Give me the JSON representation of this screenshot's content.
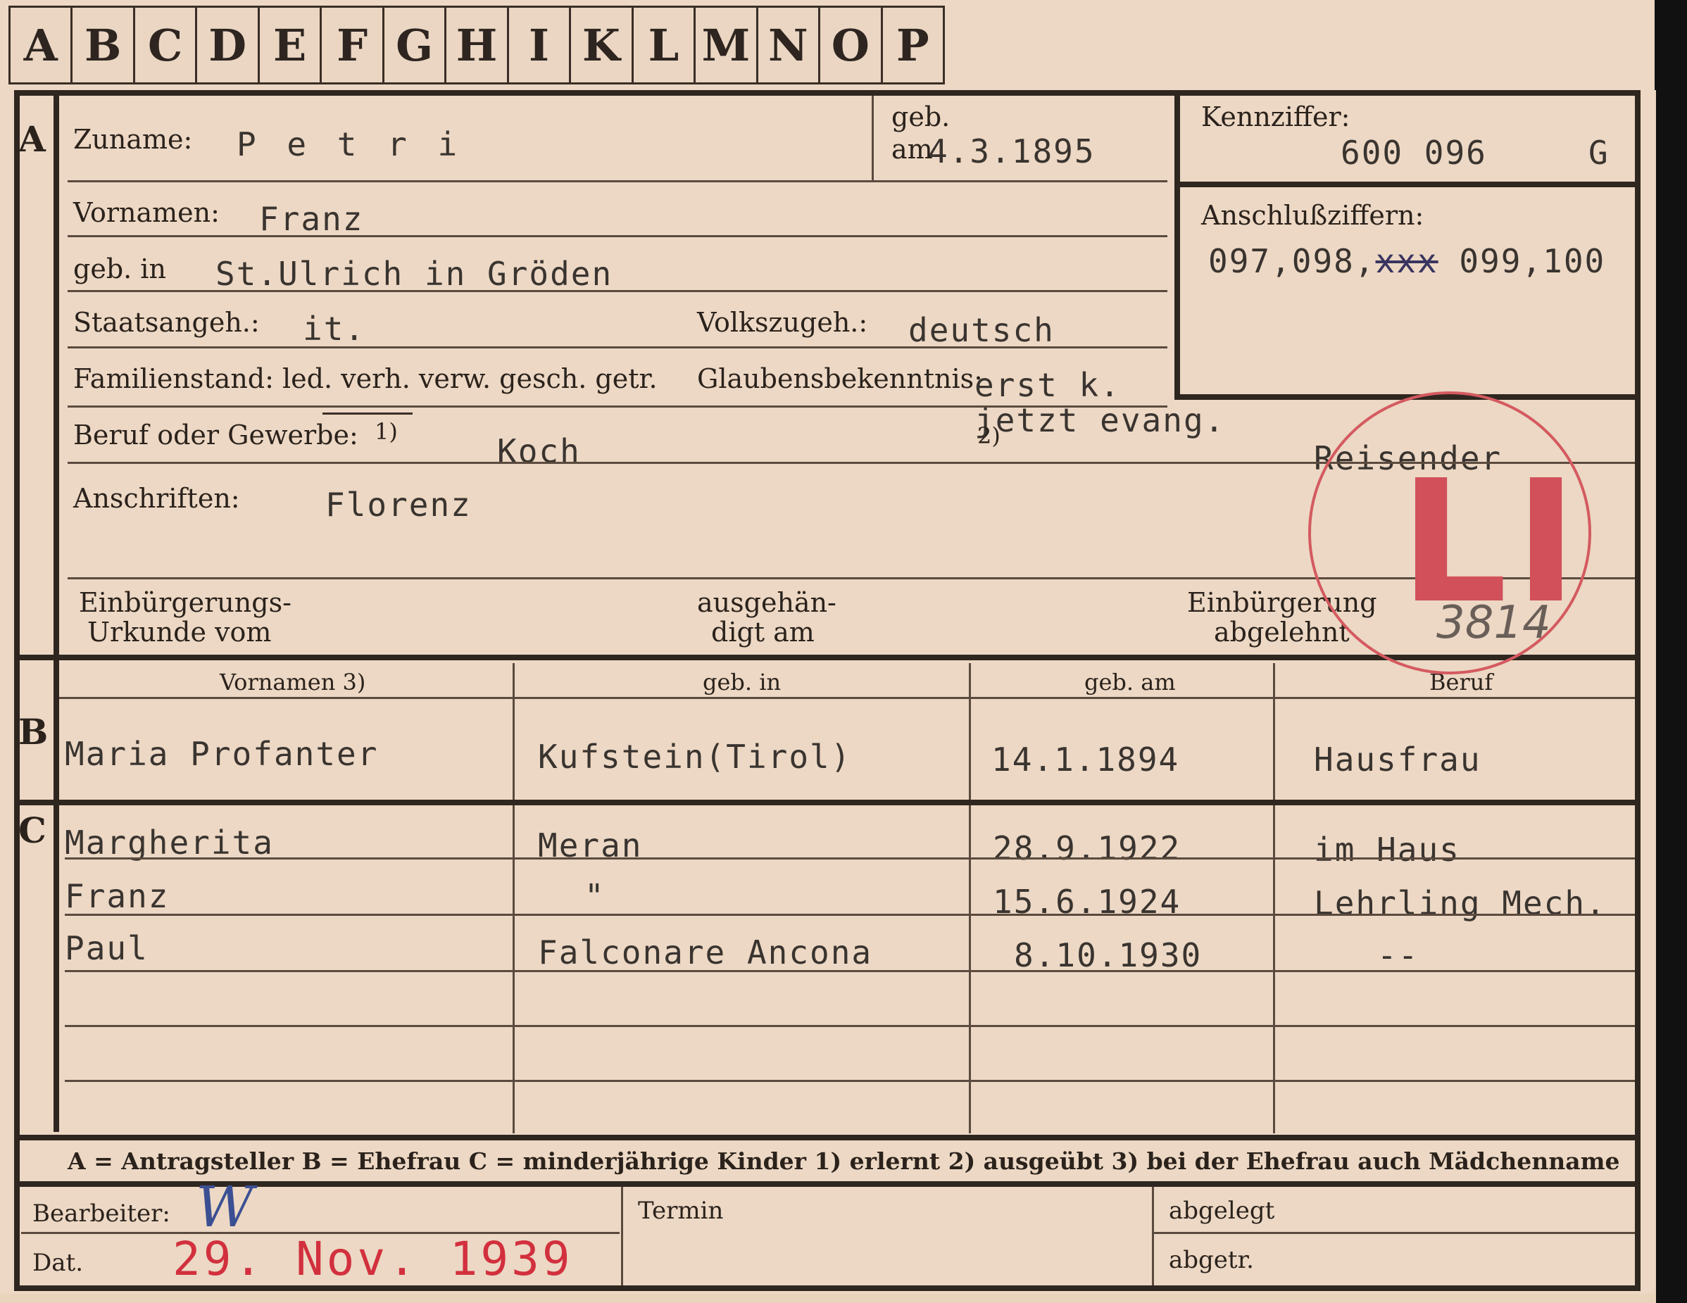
{
  "tabs": [
    "A",
    "B",
    "C",
    "D",
    "E",
    "F",
    "G",
    "H",
    "I",
    "K",
    "L",
    "M",
    "N",
    "O",
    "P"
  ],
  "section_letters": {
    "a": "A",
    "b": "B",
    "c": "C"
  },
  "applicant": {
    "surname_label": "Zuname:",
    "surname": "P e t r i",
    "born_on_label": "geb.",
    "born_on_am": "am",
    "born_on": "4.3.1895",
    "id_label": "Kennziffer:",
    "id": "600 096",
    "id_suffix": "G",
    "link_label": "Anschlußziffern:",
    "link_prefix": "097,098,",
    "link_struck": "xxx",
    "link_rest": " 099,100",
    "firstname_label": "Vornamen:",
    "firstname": "Franz",
    "birthplace_label": "geb. in",
    "birthplace": "St.Ulrich in Gröden",
    "citizenship_label": "Staatsangeh.:",
    "citizenship": "it.",
    "ethnicity_label": "Volkszugeh.:",
    "ethnicity": "deutsch",
    "marital_label": "Familienstand: led. verh. verw. gesch. getr.",
    "religion_label": "Glaubensbekenntnis:",
    "religion": "erst k.",
    "religion_now": "jetzt evang.",
    "occupation_label": "Beruf oder Gewerbe:",
    "occupation_sup1": "1)",
    "occupation_learned": "Koch",
    "occupation_sup2": "2)",
    "occupation_practised": "Reisender",
    "address_label": "Anschriften:",
    "address": "Florenz",
    "naturalization_deed_label1": "Einbürgerungs-",
    "naturalization_deed_label2": "Urkunde vom",
    "handed_out_label1": "ausgehän-",
    "handed_out_label2": "digt am",
    "rejected_label1": "Einbürgerung",
    "rejected_label2": "abgelehnt"
  },
  "table_headers": {
    "firstnames": "Vornamen 3)",
    "birthplace": "geb. in",
    "birthdate": "geb. am",
    "occupation": "Beruf"
  },
  "wife": {
    "name": "Maria Profanter",
    "birthplace": "Kufstein(Tirol)",
    "birthdate": "14.1.1894",
    "occupation": "Hausfrau"
  },
  "children": [
    {
      "name": "Margherita",
      "birthplace": "Meran",
      "birthdate": "28.9.1922",
      "occupation": "im Haus"
    },
    {
      "name": "Franz",
      "birthplace": "\"",
      "birthdate": "15.6.1924",
      "occupation": "Lehrling Mech."
    },
    {
      "name": "Paul",
      "birthplace": "Falconare Ancona",
      "birthdate": "8.10.1930",
      "occupation": "--"
    }
  ],
  "legend": "A = Antragsteller   B = Ehefrau   C = minderjährige Kinder   1) erlernt   2) ausgeübt   3) bei der Ehefrau auch Mädchenname",
  "footer": {
    "clerk_label": "Bearbeiter:",
    "clerk_initials": "W",
    "date_label": "Dat.",
    "date_stamp": "29. Nov. 1939",
    "appointment_label": "Termin",
    "filed_label": "abgelegt",
    "sent_label": "abgetr."
  },
  "stamp": {
    "letters": "LI",
    "number": "3814"
  }
}
